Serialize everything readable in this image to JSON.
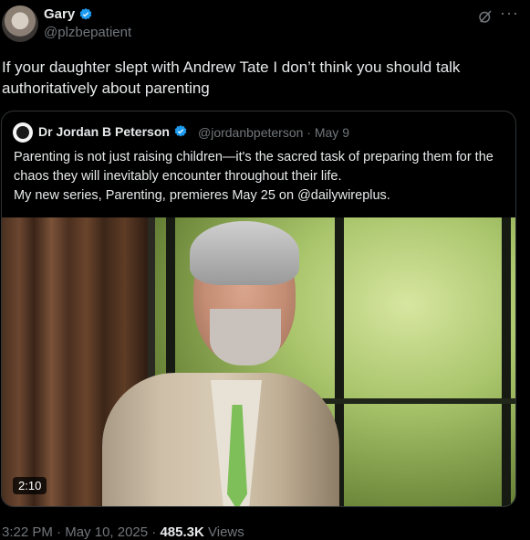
{
  "author": {
    "name": "Gary",
    "handle": "@plzbepatient"
  },
  "tweet": {
    "text": "If your daughter slept with Andrew Tate I don’t think you should talk authoritatively about parenting"
  },
  "quoted": {
    "name": "Dr Jordan B Peterson",
    "handle": "@jordanbpeterson",
    "separator": "·",
    "date": "May 9",
    "line1": "Parenting is not just raising children—it's the sacred task of preparing them for the chaos they will inevitably encounter throughout their life.",
    "line2": "My new series, Parenting, premieres May 25 on @dailywireplus.",
    "video_duration": "2:10"
  },
  "footer": {
    "time": "3:22 PM",
    "sep": "·",
    "date": "May 10, 2025",
    "views_count": "485.3K",
    "views_label": "Views"
  },
  "icons": {
    "verified": "verified-badge-icon",
    "grok": "grok-icon",
    "more": "more-icon"
  },
  "colors": {
    "background": "#000000",
    "verified": "#1d9bf0",
    "muted": "#71767b",
    "text": "#e7e9ea"
  }
}
